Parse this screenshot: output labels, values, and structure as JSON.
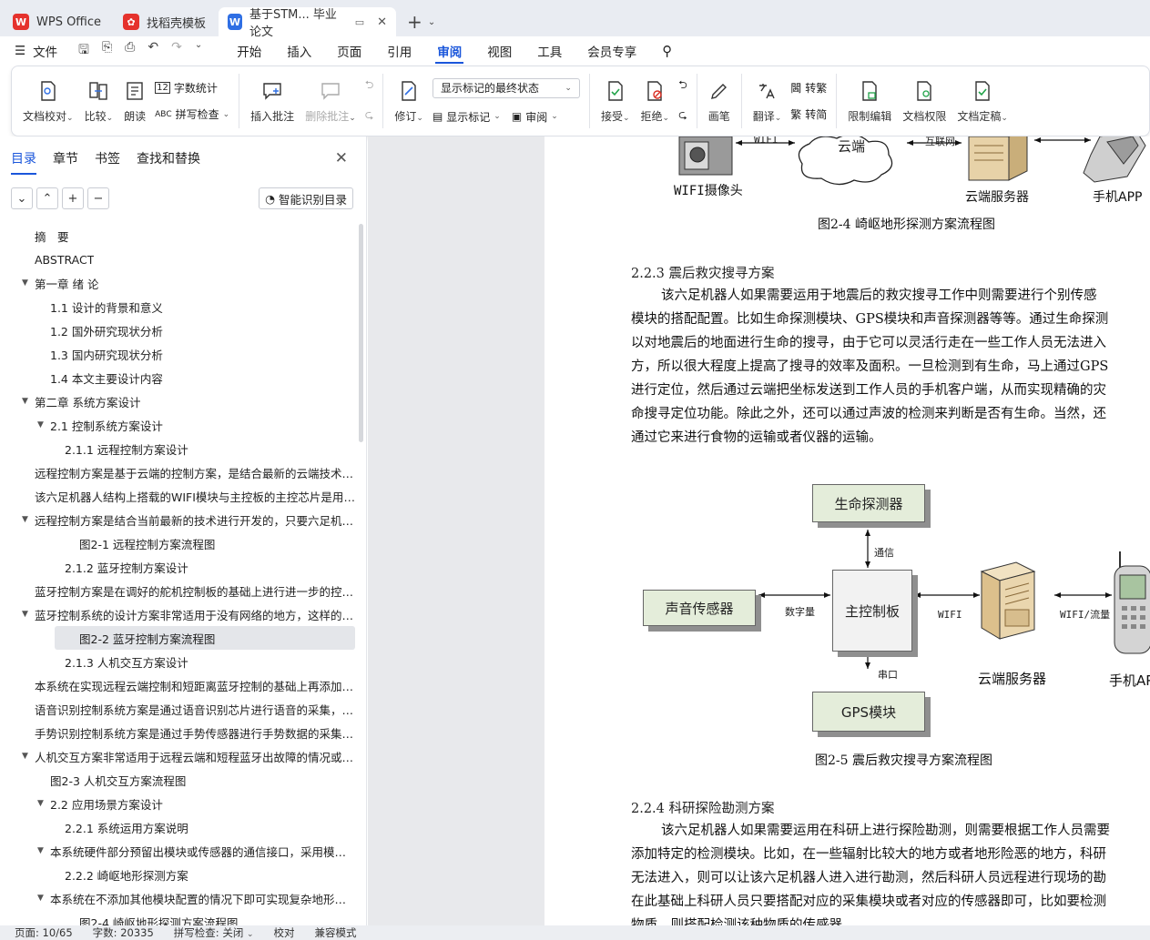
{
  "tabs": [
    {
      "label": "WPS Office"
    },
    {
      "label": "找稻壳模板"
    },
    {
      "label": "基于STM... 毕业论文"
    }
  ],
  "menu": {
    "file": "文件",
    "items": [
      "开始",
      "插入",
      "页面",
      "引用",
      "审阅",
      "视图",
      "工具",
      "会员专享"
    ],
    "active": "审阅"
  },
  "ribbon": {
    "proofread": "文档校对",
    "compare": "比较",
    "read_aloud": "朗读",
    "word_count": "字数统计",
    "spell_check": "拼写检查",
    "insert_comment": "插入批注",
    "delete_comment": "删除批注",
    "revise": "修订",
    "markup_select": "显示标记的最终状态",
    "show_markup": "显示标记",
    "review": "审阅",
    "accept": "接受",
    "reject": "拒绝",
    "pen": "画笔",
    "translate": "翻译",
    "to_traditional": "转繁",
    "to_simplified": "转简",
    "restrict_edit": "限制编辑",
    "doc_permission": "文档权限",
    "finalize": "文档定稿"
  },
  "sidebar": {
    "tabs": [
      "目录",
      "章节",
      "书签",
      "查找和替换"
    ],
    "smart_toc": "智能识别目录",
    "toc": [
      {
        "label": "摘　要",
        "indent": 0,
        "toggle": false
      },
      {
        "label": "ABSTRACT",
        "indent": 0,
        "toggle": false
      },
      {
        "label": "第一章  绪  论",
        "indent": 0,
        "toggle": true
      },
      {
        "label": "1.1  设计的背景和意义",
        "indent": 1,
        "toggle": false
      },
      {
        "label": "1.2  国外研究现状分析",
        "indent": 1,
        "toggle": false
      },
      {
        "label": "1.3  国内研究现状分析",
        "indent": 1,
        "toggle": false
      },
      {
        "label": "1.4  本文主要设计内容",
        "indent": 1,
        "toggle": false
      },
      {
        "label": "第二章  系统方案设计",
        "indent": 0,
        "toggle": true
      },
      {
        "label": "2.1  控制系统方案设计",
        "indent": 1,
        "toggle": true
      },
      {
        "label": "2.1.1  远程控制方案设计",
        "indent": 2,
        "toggle": false
      },
      {
        "label": "远程控制方案是基于云端的控制方案，是结合最新的云端技术 ...",
        "indent": 0,
        "toggle": false
      },
      {
        "label": "该六足机器人结构上搭载的WIFI模块与主控板的主控芯片是用 ...",
        "indent": 0,
        "toggle": false
      },
      {
        "label": "远程控制方案是结合当前最新的技术进行开发的，只要六足机 ...",
        "indent": 0,
        "toggle": true
      },
      {
        "label": "图2-1  远程控制方案流程图",
        "indent": 3,
        "toggle": false
      },
      {
        "label": "2.1.2  蓝牙控制方案设计",
        "indent": 2,
        "toggle": false
      },
      {
        "label": "蓝牙控制方案是在调好的舵机控制板的基础上进行进一步的控 ...",
        "indent": 0,
        "toggle": false
      },
      {
        "label": "蓝牙控制系统的设计方案非常适用于没有网络的地方，这样的 ...",
        "indent": 0,
        "toggle": true
      },
      {
        "label": "图2-2  蓝牙控制方案流程图",
        "indent": 3,
        "toggle": false,
        "selected": true
      },
      {
        "label": "2.1.3  人机交互方案设计",
        "indent": 2,
        "toggle": false
      },
      {
        "label": "本系统在实现远程云端控制和短距离蓝牙控制的基础上再添加 ...",
        "indent": 0,
        "toggle": false
      },
      {
        "label": "语音识别控制系统方案是通过语音识别芯片进行语音的采集， ...",
        "indent": 0,
        "toggle": false
      },
      {
        "label": "手势识别控制系统方案是通过手势传感器进行手势数据的采集 ...",
        "indent": 0,
        "toggle": false
      },
      {
        "label": "人机交互方案非常适用于远程云端和短程蓝牙出故障的情况或 ...",
        "indent": 0,
        "toggle": true
      },
      {
        "label": "图2-3  人机交互方案流程图",
        "indent": 1,
        "toggle": false
      },
      {
        "label": "2.2  应用场景方案设计",
        "indent": 1,
        "toggle": true
      },
      {
        "label": "2.2.1  系统运用方案说明",
        "indent": 2,
        "toggle": false
      },
      {
        "label": "本系统硬件部分预留出模块或传感器的通信接口，采用模块 ...",
        "indent": 1,
        "toggle": true
      },
      {
        "label": "2.2.2  崎岖地形探测方案",
        "indent": 2,
        "toggle": false
      },
      {
        "label": "本系统在不添加其他模块配置的情况下即可实现复杂地形的 ...",
        "indent": 1,
        "toggle": true
      },
      {
        "label": "图2-4  崎岖地形探测方案流程图",
        "indent": 3,
        "toggle": false
      }
    ]
  },
  "document": {
    "fig24": {
      "wifi": "WIFI",
      "cloud": "云端",
      "internet": "互联网",
      "camera": "WIFI摄像头",
      "server": "云端服务器",
      "phone": "手机APP",
      "caption": "图2-4  崎岖地形探测方案流程图"
    },
    "heading_223": "2.2.3  震后救灾搜寻方案",
    "para_223": [
      "该六足机器人如果需要运用于地震后的救灾搜寻工作中则需要进行个别传感",
      "模块的搭配配置。比如生命探测模块、GPS模块和声音探测器等等。通过生命探测",
      "以对地震后的地面进行生命的搜寻，由于它可以灵活行走在一些工作人员无法进入",
      "方，所以很大程度上提高了搜寻的效率及面积。一旦检测到有生命，马上通过GPS",
      "进行定位，然后通过云端把坐标发送到工作人员的手机客户端，从而实现精确的灾",
      "命搜寻定位功能。除此之外，还可以通过声波的检测来判断是否有生命。当然，还",
      "通过它来进行食物的运输或者仪器的运输。"
    ],
    "fig25": {
      "life": "生命探测器",
      "comm": "通信",
      "sound": "声音传感器",
      "digital": "数字量",
      "main": "主控制板",
      "wifi": "WIFI",
      "server": "云端服务器",
      "wifi_flow": "WIFI/流量",
      "phone": "手机AP",
      "serial": "串口",
      "gps": "GPS模块",
      "caption": "图2-5   震后救灾搜寻方案流程图"
    },
    "heading_224": "2.2.4  科研探险勘测方案",
    "para_224": [
      "该六足机器人如果需要运用在科研上进行探险勘测，则需要根据工作人员需要",
      "添加特定的检测模块。比如，在一些辐射比较大的地方或者地形险恶的地方，科研",
      "无法进入，则可以让该六足机器人进入进行勘测，然后科研人员远程进行现场的勘",
      "在此基础上科研人员只要搭配对应的采集模块或者对应的传感器即可，比如要检测",
      "物质，则搭配检测该种物质的传感器"
    ]
  },
  "status": {
    "page": "页面: 10/65",
    "words": "字数: 20335",
    "spell": "拼写检查: 关闭",
    "proof": "校对",
    "compat": "兼容模式"
  },
  "colors": {
    "accent": "#1a56db",
    "box_fill": "#e4edda"
  }
}
